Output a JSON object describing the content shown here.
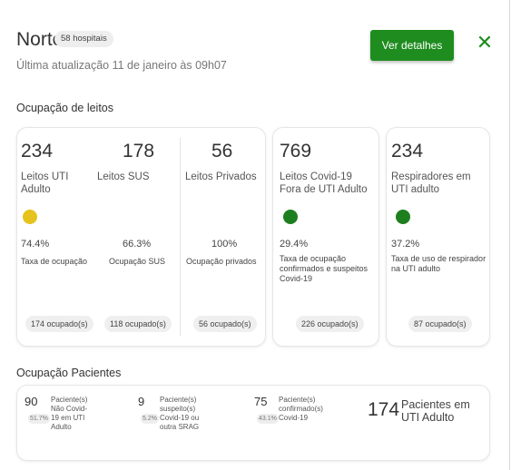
{
  "header": {
    "title": "Norte",
    "hospitals_badge": "58 hospitais",
    "updated": "Última atualização 11 de janeiro às 09h07",
    "details_button": "Ver detalhes",
    "close_icon": "close-x-icon"
  },
  "beds": {
    "section_title": "Ocupação de leitos",
    "uti": {
      "count": "234",
      "label": "Leitos UTI Adulto",
      "status_color": "#e6c31c",
      "pct": "74.4%",
      "desc": "Taxa de ocupação",
      "pill": "174 ocupado(s)"
    },
    "sus": {
      "count": "178",
      "label": "Leitos SUS",
      "pct": "66.3%",
      "desc": "Ocupação SUS",
      "pill": "118 ocupado(s)"
    },
    "private": {
      "count": "56",
      "label": "Leitos Privados",
      "pct": "100%",
      "desc": "Ocupação privados",
      "pill": "56 ocupado(s)"
    },
    "covid": {
      "count": "769",
      "label": "Leitos Covid-19 Fora de UTI Adulto",
      "status_color": "#1e7f1e",
      "pct": "29.4%",
      "desc": "Taxa de ocupação confirmados e suspeitos Covid-19",
      "pill": "226 ocupado(s)"
    },
    "resp": {
      "count": "234",
      "label": "Respiradores em UTI adulto",
      "status_color": "#1e7f1e",
      "pct": "37.2%",
      "desc": "Taxa de uso de respirador na UTI adulto",
      "pill": "87 ocupado(s)"
    }
  },
  "patients": {
    "section_title": "Ocupação Pacientes",
    "non_covid": {
      "count": "90",
      "pct": "51.7%",
      "text": "Paciente(s) Não Covid-19 em UTI Adulto"
    },
    "suspected": {
      "count": "9",
      "pct": "5.2%",
      "text": "Paciente(s) suspeito(s) Covid-19 ou outra SRAG"
    },
    "confirmed": {
      "count": "75",
      "pct": "43.1%",
      "text": "Paciente(s) confirmado(s) Covid-19"
    },
    "total": {
      "count": "174",
      "text": "Pacientes em UTI Adulto"
    }
  }
}
